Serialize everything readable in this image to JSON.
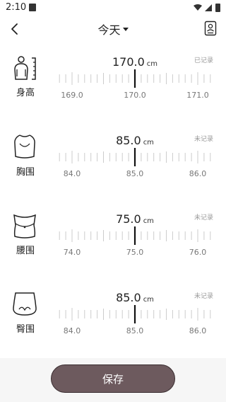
{
  "status_bar": {
    "time": "2:10"
  },
  "header": {
    "date_label": "今天"
  },
  "rows": [
    {
      "label": "身高",
      "value": "170.0",
      "unit": "cm",
      "status": "已记录",
      "ticks": [
        "169.0",
        "170.0",
        "171.0"
      ]
    },
    {
      "label": "胸围",
      "value": "85.0",
      "unit": "cm",
      "status": "未记录",
      "ticks": [
        "84.0",
        "85.0",
        "86.0"
      ]
    },
    {
      "label": "腰围",
      "value": "75.0",
      "unit": "cm",
      "status": "未记录",
      "ticks": [
        "74.0",
        "75.0",
        "76.0"
      ]
    },
    {
      "label": "臀围",
      "value": "85.0",
      "unit": "cm",
      "status": "未记录",
      "ticks": [
        "84.0",
        "85.0",
        "86.0"
      ]
    }
  ],
  "save_label": "保存",
  "icons": {
    "back": "back-arrow-icon",
    "date_dropdown": "caret-down-icon",
    "record": "record-list-icon",
    "height": "height-body-icon",
    "chest": "chest-icon",
    "waist": "waist-icon",
    "hip": "hip-icon"
  },
  "colors": {
    "accent": "#6d5a5e",
    "tick": "#cccccc",
    "indicator": "#111111"
  }
}
